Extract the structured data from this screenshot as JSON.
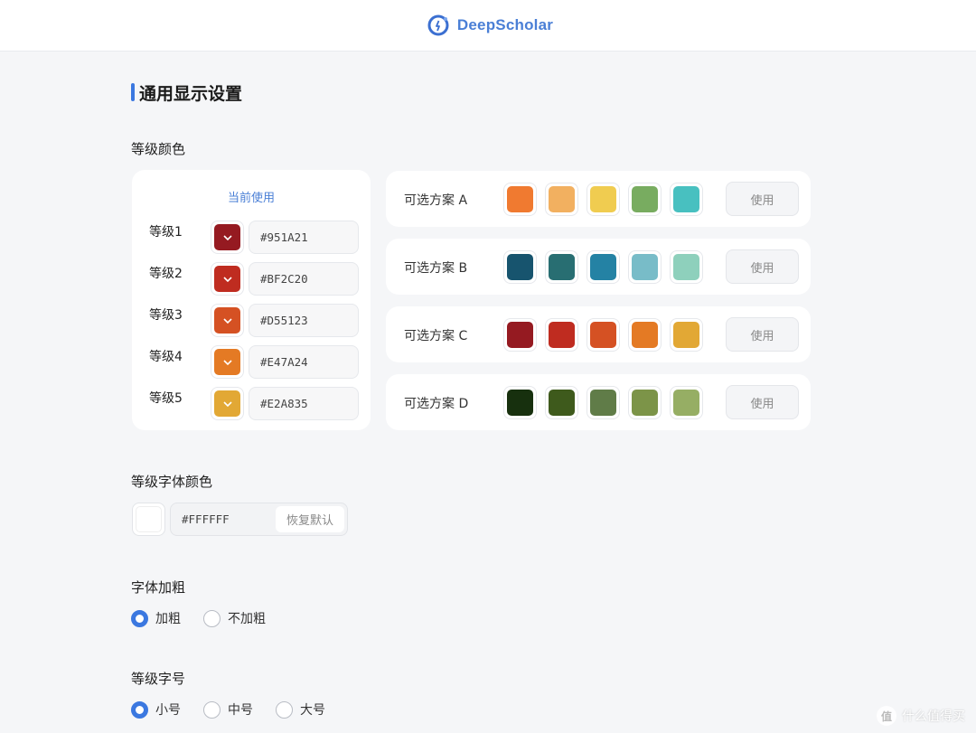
{
  "app": {
    "name": "DeepScholar"
  },
  "page_title": "通用显示设置",
  "level_colors": {
    "label": "等级颜色",
    "current_title": "当前使用",
    "levels": [
      {
        "name": "等级1",
        "hex": "#951A21",
        "color": "#951A21"
      },
      {
        "name": "等级2",
        "hex": "#BF2C20",
        "color": "#BF2C20"
      },
      {
        "name": "等级3",
        "hex": "#D55123",
        "color": "#D55123"
      },
      {
        "name": "等级4",
        "hex": "#E47A24",
        "color": "#E47A24"
      },
      {
        "name": "等级5",
        "hex": "#E2A835",
        "color": "#E2A835"
      }
    ],
    "use_label": "使用",
    "schemes": [
      {
        "name": "可选方案 A",
        "colors": [
          "#F07A30",
          "#F2B060",
          "#F0CC50",
          "#78AC60",
          "#48C0C0"
        ]
      },
      {
        "name": "可选方案 B",
        "colors": [
          "#17546E",
          "#286E72",
          "#2482A4",
          "#78BCC8",
          "#8ED0BC"
        ]
      },
      {
        "name": "可选方案 C",
        "colors": [
          "#951A21",
          "#BF2C20",
          "#D55123",
          "#E47A24",
          "#E2A835"
        ]
      },
      {
        "name": "可选方案 D",
        "colors": [
          "#17300E",
          "#3E5A1C",
          "#607C48",
          "#7C9448",
          "#96AE64"
        ]
      }
    ]
  },
  "font_color": {
    "label": "等级字体颜色",
    "value": "#FFFFFF",
    "color": "#FFFFFF",
    "reset_label": "恢复默认"
  },
  "font_bold": {
    "label": "字体加粗",
    "options": [
      "加粗",
      "不加粗"
    ],
    "selected": "加粗"
  },
  "font_size": {
    "label": "等级字号",
    "options": [
      "小号",
      "中号",
      "大号"
    ],
    "selected": "小号"
  },
  "watermark": {
    "text": "什么值得买",
    "icon_text": "值"
  }
}
